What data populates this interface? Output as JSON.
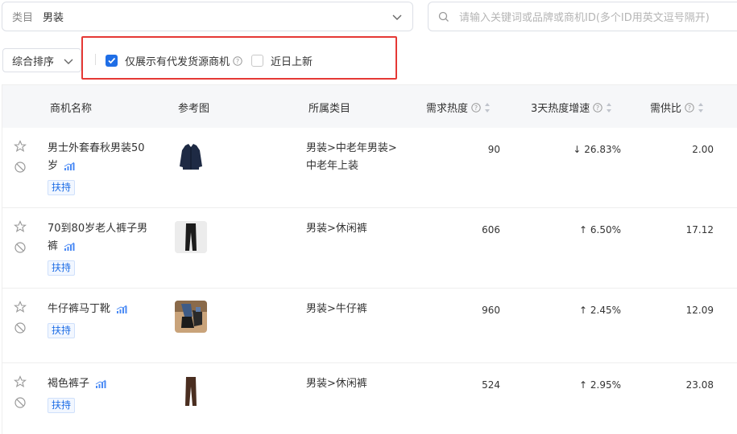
{
  "filters": {
    "category_label": "类目",
    "category_value": "男装",
    "search_placeholder": "请输入关键词或品牌或商机ID(多个ID用英文逗号隔开)",
    "sort_value": "综合排序",
    "checkbox_dropship": "仅展示有代发货源商机",
    "checkbox_new": "近日上新"
  },
  "table": {
    "headers": {
      "name": "商机名称",
      "image": "参考图",
      "category": "所属类目",
      "heat": "需求热度",
      "growth": "3天热度增速",
      "ratio": "需供比"
    },
    "rows": [
      {
        "name_line1": "男士外套春秋男装50",
        "name_line2": "岁",
        "tag": "扶持",
        "category_line1": "男装>中老年男装>",
        "category_line2": "中老年上装",
        "heat": "90",
        "growth_dir": "down",
        "growth": "26.83%",
        "ratio": "2.00"
      },
      {
        "name_line1": "70到80岁老人裤子男",
        "name_line2": "裤",
        "tag": "扶持",
        "category_line1": "男装>休闲裤",
        "category_line2": "",
        "heat": "606",
        "growth_dir": "up",
        "growth": "6.50%",
        "ratio": "17.12"
      },
      {
        "name_line1": "牛仔裤马丁靴",
        "name_line2": "",
        "tag": "扶持",
        "category_line1": "男装>牛仔裤",
        "category_line2": "",
        "heat": "960",
        "growth_dir": "up",
        "growth": "2.45%",
        "ratio": "12.09"
      },
      {
        "name_line1": "褐色裤子",
        "name_line2": "",
        "tag": "扶持",
        "category_line1": "男装>休闲裤",
        "category_line2": "",
        "heat": "524",
        "growth_dir": "up",
        "growth": "2.95%",
        "ratio": "23.08"
      }
    ]
  },
  "colors": {
    "accent": "#1f6ee6",
    "highlight": "#e53935",
    "header_bg": "#f6f7f9"
  }
}
